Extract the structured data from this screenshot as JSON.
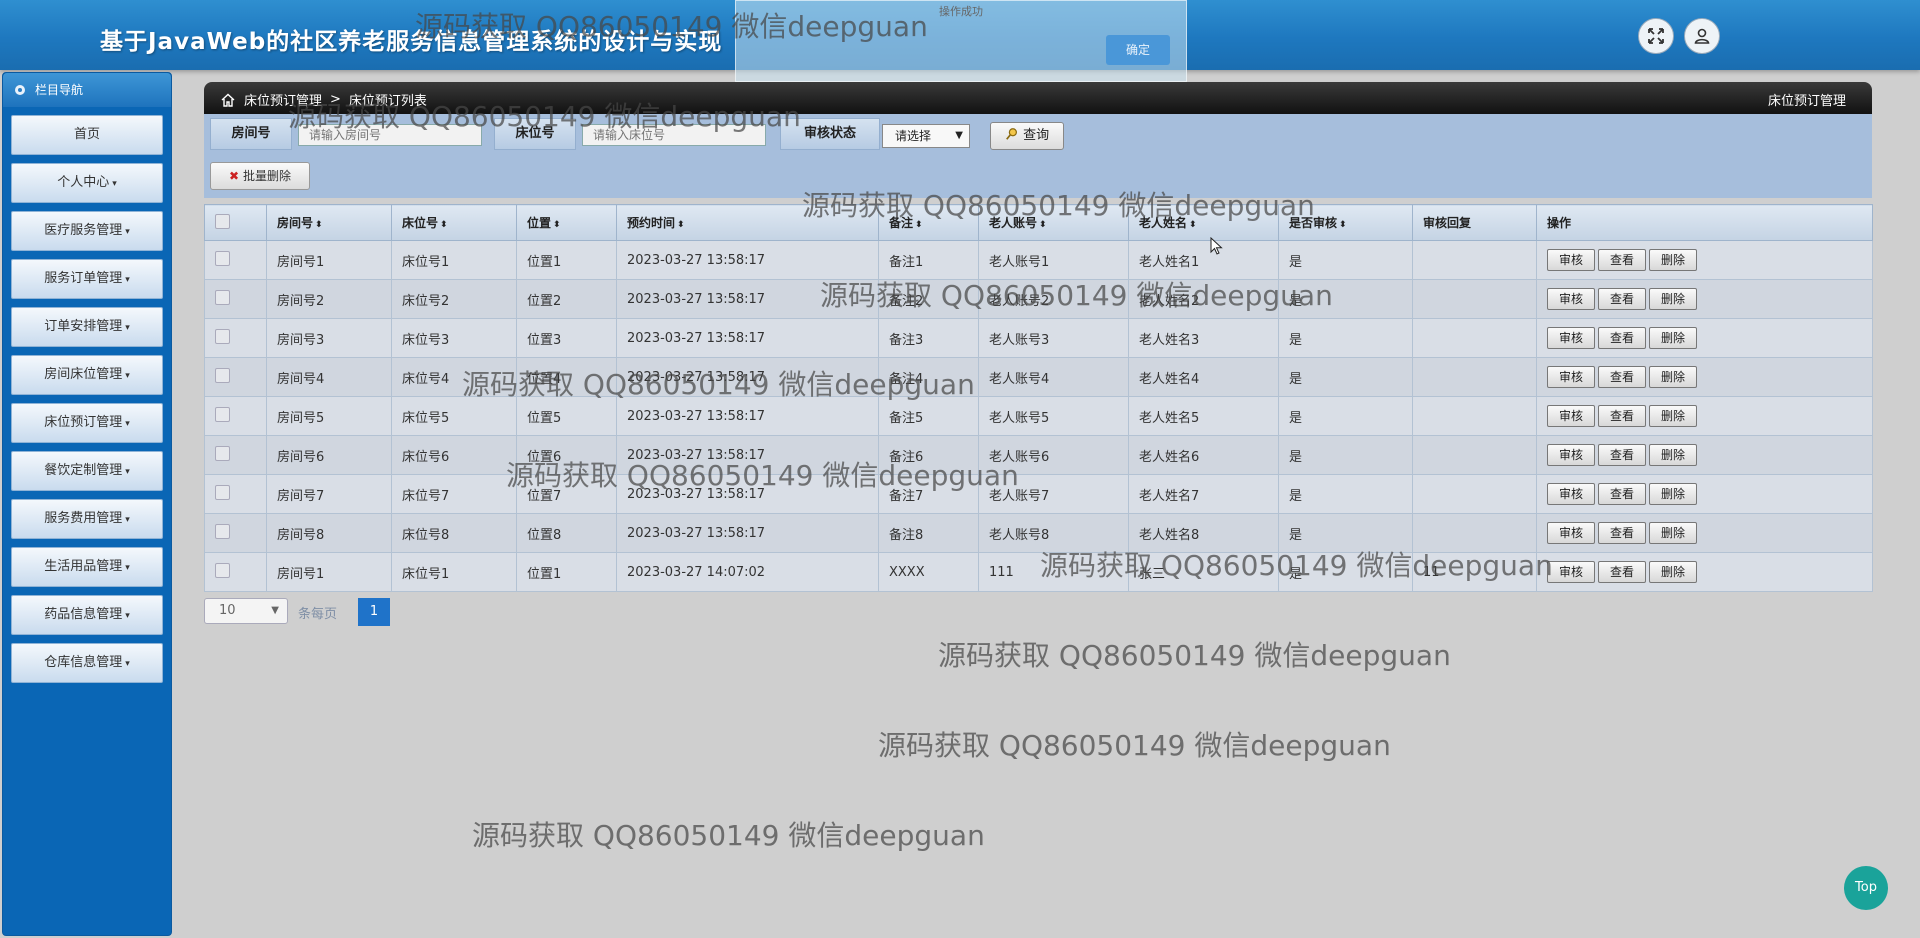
{
  "header": {
    "title": "基于JavaWeb的社区养老服务信息管理系统的设计与实现",
    "fullscreen_icon": "expand-arrows-icon",
    "user_icon": "user-icon"
  },
  "toast": {
    "message": "操作成功",
    "confirm_label": "确定"
  },
  "sidebar": {
    "title": "栏目导航",
    "items": [
      {
        "label": "首页",
        "caret": ""
      },
      {
        "label": "个人中心",
        "caret": "▾"
      },
      {
        "label": "医疗服务管理",
        "caret": "▾"
      },
      {
        "label": "服务订单管理",
        "caret": "▾"
      },
      {
        "label": "订单安排管理",
        "caret": "▾"
      },
      {
        "label": "房间床位管理",
        "caret": "▾"
      },
      {
        "label": "床位预订管理",
        "caret": "▾"
      },
      {
        "label": "餐饮定制管理",
        "caret": "▾"
      },
      {
        "label": "服务费用管理",
        "caret": "▾"
      },
      {
        "label": "生活用品管理",
        "caret": "▾"
      },
      {
        "label": "药品信息管理",
        "caret": "▾"
      },
      {
        "label": "仓库信息管理",
        "caret": "▾"
      }
    ]
  },
  "panel": {
    "breadcrumb_root": "床位预订管理",
    "breadcrumb_sep": ">",
    "breadcrumb_current": "床位预订列表",
    "right_title": "床位预订管理"
  },
  "filters": {
    "room_label": "房间号",
    "room_placeholder": "请输入房间号",
    "bed_label": "床位号",
    "bed_placeholder": "请输入床位号",
    "status_label": "审核状态",
    "status_value": "请选择",
    "search_label": "查询",
    "batch_delete_label": "批量删除"
  },
  "table": {
    "headers": [
      "房间号",
      "床位号",
      "位置",
      "预约时间",
      "备注",
      "老人账号",
      "老人姓名",
      "是否审核",
      "审核回复",
      "操作"
    ],
    "sort_glyph": "⬍",
    "actions": [
      "审核",
      "查看",
      "删除"
    ],
    "rows": [
      [
        "房间号1",
        "床位号1",
        "位置1",
        "2023-03-27 13:58:17",
        "备注1",
        "老人账号1",
        "老人姓名1",
        "是",
        ""
      ],
      [
        "房间号2",
        "床位号2",
        "位置2",
        "2023-03-27 13:58:17",
        "备注2",
        "老人账号2",
        "老人姓名2",
        "是",
        ""
      ],
      [
        "房间号3",
        "床位号3",
        "位置3",
        "2023-03-27 13:58:17",
        "备注3",
        "老人账号3",
        "老人姓名3",
        "是",
        ""
      ],
      [
        "房间号4",
        "床位号4",
        "位置4",
        "2023-03-27 13:58:17",
        "备注4",
        "老人账号4",
        "老人姓名4",
        "是",
        ""
      ],
      [
        "房间号5",
        "床位号5",
        "位置5",
        "2023-03-27 13:58:17",
        "备注5",
        "老人账号5",
        "老人姓名5",
        "是",
        ""
      ],
      [
        "房间号6",
        "床位号6",
        "位置6",
        "2023-03-27 13:58:17",
        "备注6",
        "老人账号6",
        "老人姓名6",
        "是",
        ""
      ],
      [
        "房间号7",
        "床位号7",
        "位置7",
        "2023-03-27 13:58:17",
        "备注7",
        "老人账号7",
        "老人姓名7",
        "是",
        ""
      ],
      [
        "房间号8",
        "床位号8",
        "位置8",
        "2023-03-27 13:58:17",
        "备注8",
        "老人账号8",
        "老人姓名8",
        "是",
        ""
      ],
      [
        "房间号1",
        "床位号1",
        "位置1",
        "2023-03-27 14:07:02",
        "XXXX",
        "111",
        "张三",
        "是",
        "11"
      ]
    ]
  },
  "pager": {
    "page_size": "10",
    "page_size_label": "条每页",
    "current_page": "1"
  },
  "top_button": "Top",
  "watermark": "源码获取 QQ86050149 微信deepguan"
}
